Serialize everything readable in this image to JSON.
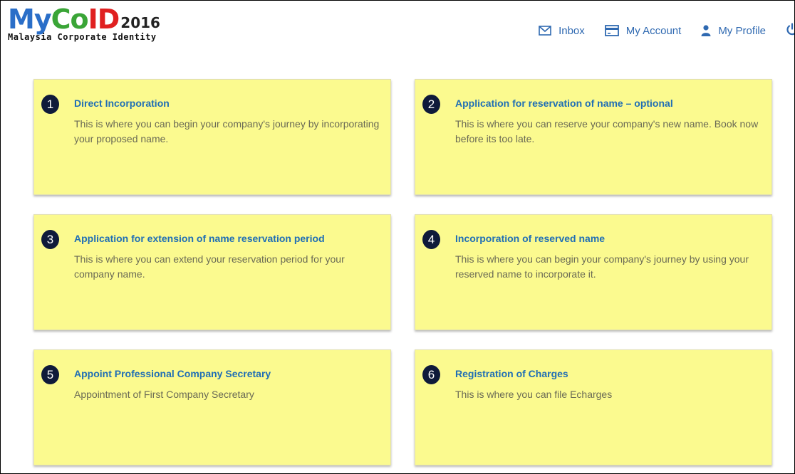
{
  "logo": {
    "my": "My",
    "co": "Co",
    "id": "ID",
    "year": "2016",
    "subtitle": "Malaysia Corporate Identity"
  },
  "nav": {
    "inbox": "Inbox",
    "my_account": "My Account",
    "my_profile": "My Profile",
    "icons": [
      "envelope-icon",
      "credit-card-icon",
      "user-icon",
      "power-icon"
    ]
  },
  "colors": {
    "card_bg": "#fbfa8f",
    "badge_bg": "#0f1a3a",
    "title": "#1f6eb5",
    "link": "#2f69b1"
  },
  "cards": [
    {
      "number": "1",
      "title": "Direct Incorporation",
      "description": "This is where you can begin your company's journey by incorporating your proposed name."
    },
    {
      "number": "2",
      "title": "Application for reservation of name – optional",
      "description": "This is where you can reserve your company's new name. Book now before its too late."
    },
    {
      "number": "3",
      "title": "Application for extension of name reservation period",
      "description": "This is where you can extend your reservation period for your company name."
    },
    {
      "number": "4",
      "title": "Incorporation of reserved name",
      "description": "This is where you can begin your company's journey by using your reserved name to incorporate it."
    },
    {
      "number": "5",
      "title": "Appoint Professional Company Secretary",
      "description": "Appointment of First Company Secretary"
    },
    {
      "number": "6",
      "title": "Registration of Charges",
      "description": "This is where you can file Echarges"
    }
  ]
}
